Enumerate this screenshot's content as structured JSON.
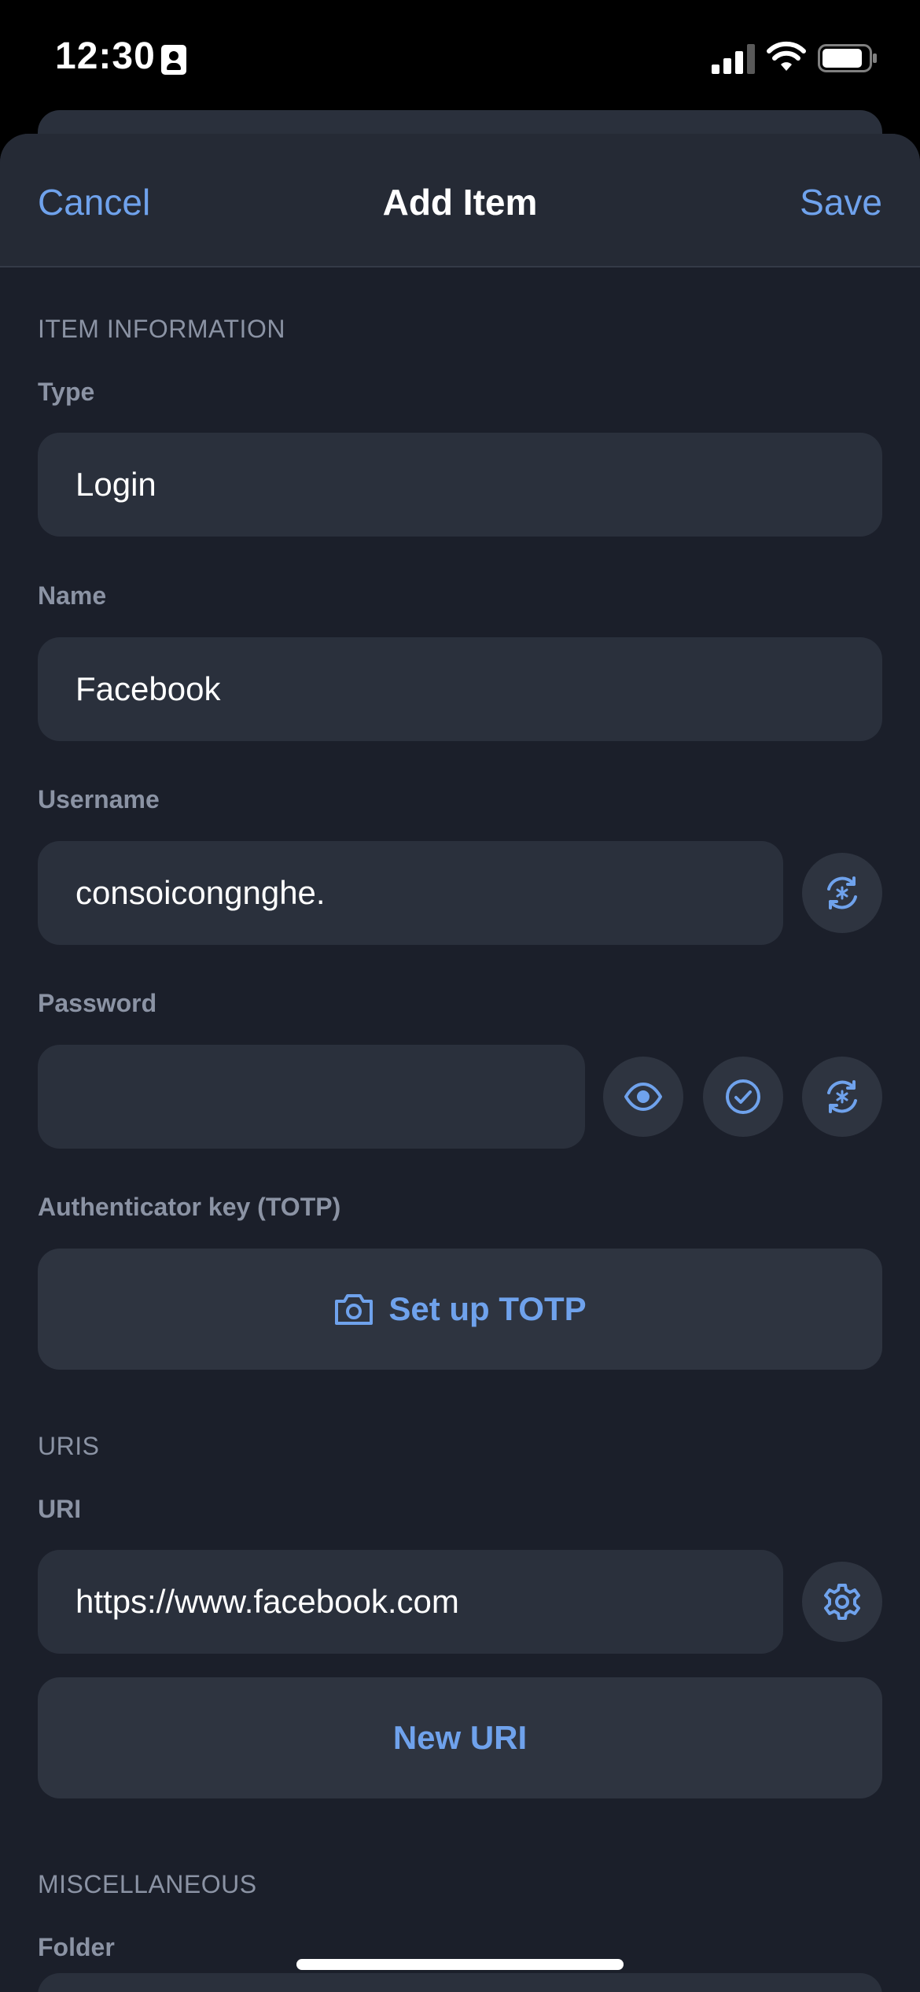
{
  "status_bar": {
    "time": "12:30"
  },
  "nav": {
    "cancel": "Cancel",
    "title": "Add Item",
    "save": "Save"
  },
  "item_information": {
    "section_title": "ITEM INFORMATION",
    "type_label": "Type",
    "type_value": "Login",
    "name_label": "Name",
    "name_value": "Facebook",
    "username_label": "Username",
    "username_value": "consoicongnghe.",
    "password_label": "Password",
    "password_value": "",
    "totp_label": "Authenticator key (TOTP)",
    "totp_button": "Set up TOTP"
  },
  "uris": {
    "section_title": "URIS",
    "uri_label": "URI",
    "uri_value": "https://www.facebook.com",
    "new_uri_button": "New URI"
  },
  "miscellaneous": {
    "section_title": "MISCELLANEOUS",
    "folder_label": "Folder"
  },
  "colors": {
    "accent": "#6fa2ec",
    "background": "#1b1f2a",
    "field": "#2a303c",
    "label": "#8b93a4"
  },
  "icons": [
    "contact-card-icon",
    "cellular-signal-icon",
    "wifi-icon",
    "battery-icon",
    "regenerate-icon",
    "eye-icon",
    "check-circle-icon",
    "camera-icon",
    "gear-icon"
  ]
}
